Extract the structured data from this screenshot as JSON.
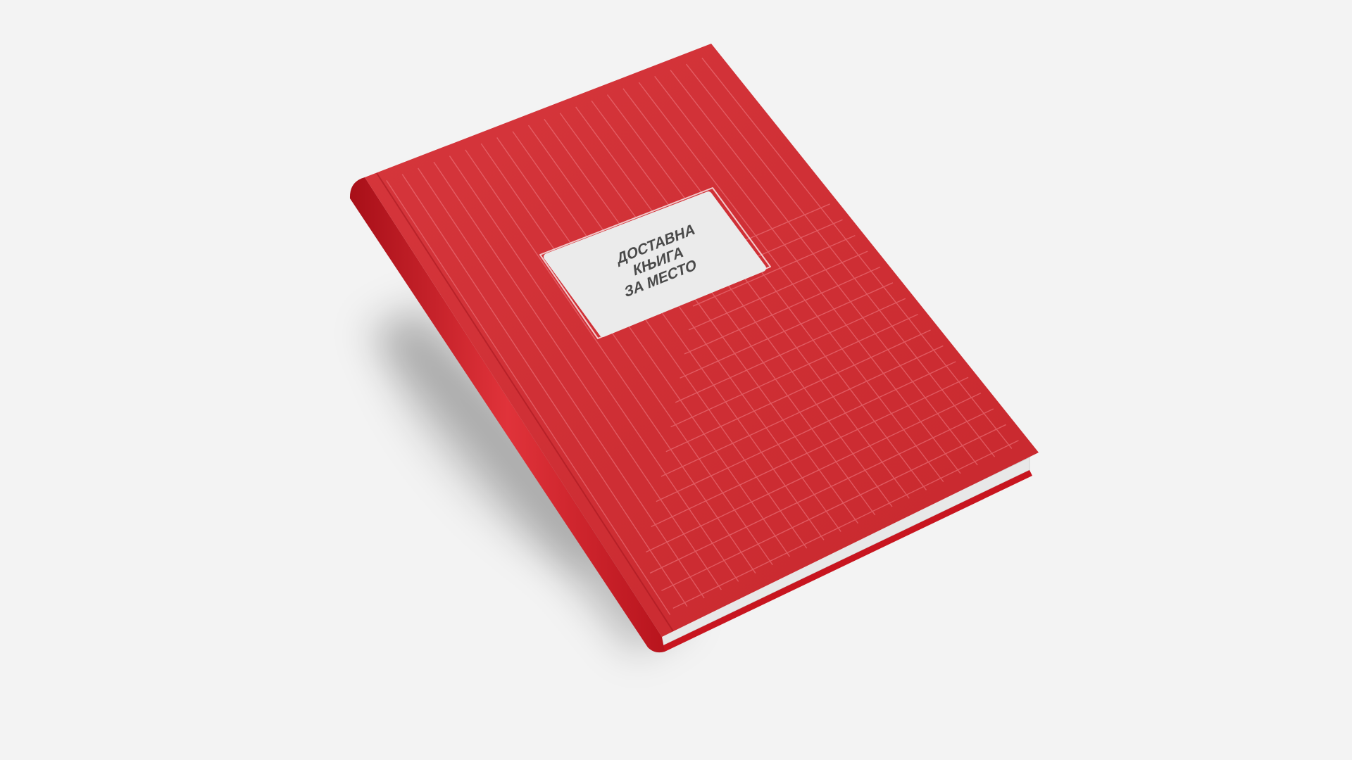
{
  "scene": {
    "background_color": "#f3f3f3",
    "cover_color": "#d42a30",
    "spine_color": "#c8151f",
    "label_color": "#ebebeb",
    "text_color": "#4a4a4a"
  },
  "book": {
    "title_lines": [
      "ДОСТАВНА",
      "КЊИГА",
      "ЗА МЕСТО"
    ]
  }
}
